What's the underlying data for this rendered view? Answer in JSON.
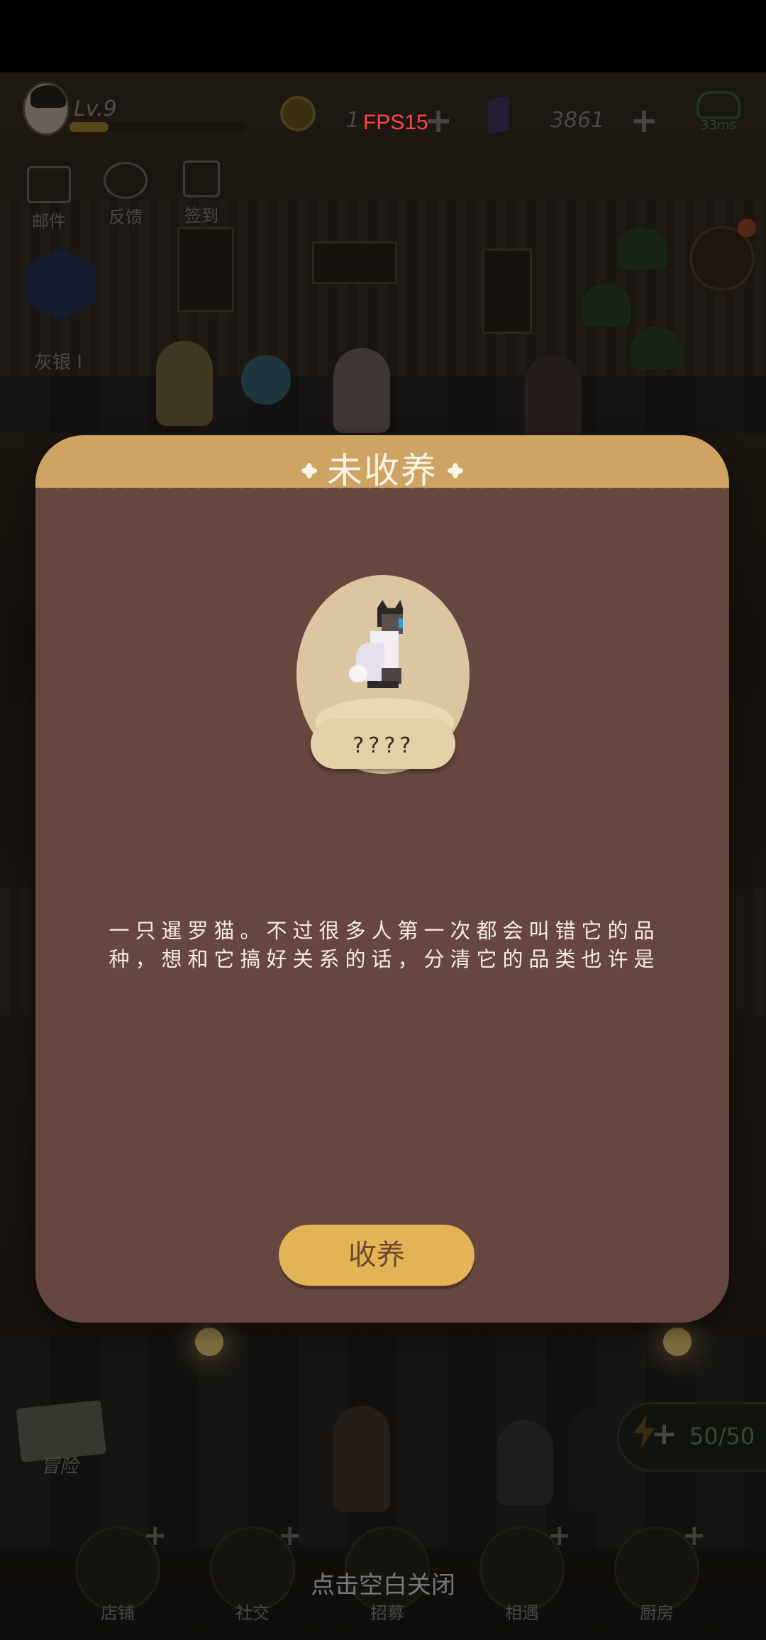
{
  "hud": {
    "level": "Lv.9",
    "xp_fraction": 0.22,
    "coins": "1",
    "fps": "FPS15",
    "gems": "3861",
    "ping": "33ms"
  },
  "side_menu": {
    "mail": "邮件",
    "feedback": "反馈",
    "checkin": "签到",
    "rank": "灰银 I"
  },
  "modal": {
    "title": "未收养",
    "pet_name": "????",
    "description": "一只暹罗猫。不过很多人第一次都会叫错它的品种，想和它搞好关系的话，分清它的品类也许是",
    "adopt_button": "收养"
  },
  "close_hint": "点击空白关闭",
  "energy": "50/50",
  "adventure": "冒险",
  "bottom_nav": [
    "店铺",
    "社交",
    "招募",
    "相遇",
    "厨房"
  ],
  "colors": {
    "modal_bg": "#66463e",
    "modal_header": "#cda464",
    "button": "#e3b456",
    "fps_text": "#ff4545"
  }
}
